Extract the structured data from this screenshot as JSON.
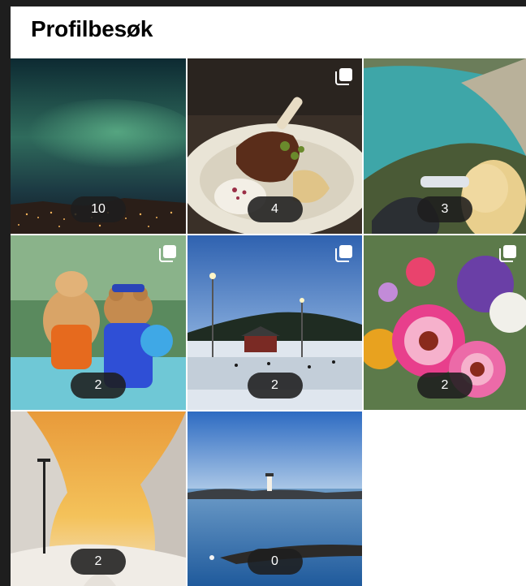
{
  "header": {
    "title": "Profilbesøk"
  },
  "posts": [
    {
      "name": "aurora-night-city",
      "count": "10",
      "multi": false
    },
    {
      "name": "lamb-dish-plate",
      "count": "4",
      "multi": true
    },
    {
      "name": "coastal-cliff-view",
      "count": "3",
      "multi": false
    },
    {
      "name": "mascots-pool",
      "count": "2",
      "multi": true
    },
    {
      "name": "ice-rink-evening",
      "count": "2",
      "multi": true
    },
    {
      "name": "flower-bouquet",
      "count": "2",
      "multi": true
    },
    {
      "name": "snowy-sunset-forest",
      "count": "2",
      "multi": false
    },
    {
      "name": "lighthouse-sea",
      "count": "0",
      "multi": false
    }
  ],
  "colors": {
    "background": "#ffffff",
    "frame_bg": "#1e1e1e",
    "pill_bg": "#1e1e1e",
    "pill_text": "#ffffff"
  },
  "icons": {
    "multi_post": "carousel-icon"
  }
}
